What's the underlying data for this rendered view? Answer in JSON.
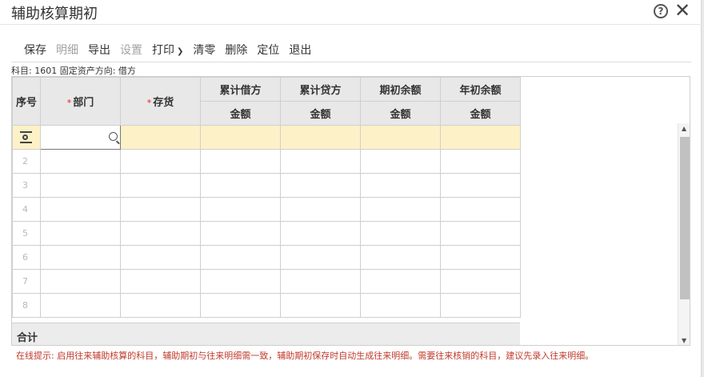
{
  "dialog": {
    "title": "辅助核算期初",
    "help_icon": "help-circle-icon",
    "close_icon": "close-icon"
  },
  "toolbar": {
    "save": "保存",
    "detail": "明细",
    "export": "导出",
    "settings": "设置",
    "print": "打印",
    "clear": "清零",
    "delete": "删除",
    "locate": "定位",
    "exit": "退出"
  },
  "subject": "科目: 1601 固定资产方向: 借方",
  "grid": {
    "headers": {
      "seq": "序号",
      "dept": "部门",
      "inventory": "存货",
      "cum_debit": "累计借方",
      "cum_credit": "累计贷方",
      "opening": "期初余额",
      "year_opening": "年初余额",
      "amount": "金额",
      "required_mark": "*"
    },
    "rows": [
      "",
      "2",
      "3",
      "4",
      "5",
      "6",
      "7",
      "8"
    ],
    "total_label": "合计"
  },
  "hint": "在线提示: 启用往来辅助核算的科目，辅助期初与往来明细需一致，辅助期初保存时自动生成往来明细。需要往来核销的科目，建议先录入往来明细。",
  "colors": {
    "active_row": "#fdf1c7",
    "header_bg": "#e8e8e8",
    "required": "#e2231a",
    "hint": "#c0392b"
  }
}
